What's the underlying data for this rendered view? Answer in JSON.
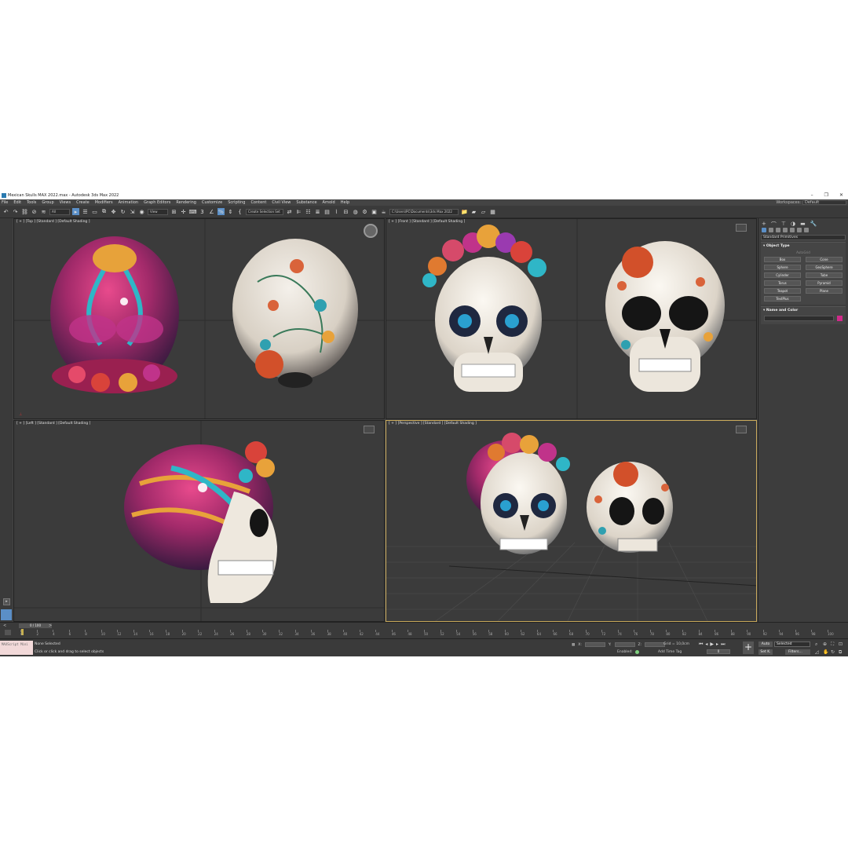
{
  "window": {
    "title": "Mexican Skulls MAX 2022.max - Autodesk 3ds Max 2022",
    "min_glyph": "–",
    "max_glyph": "❐",
    "close_glyph": "✕"
  },
  "menu": [
    "File",
    "Edit",
    "Tools",
    "Group",
    "Views",
    "Create",
    "Modifiers",
    "Animation",
    "Graph Editors",
    "Rendering",
    "Customize",
    "Scripting",
    "Content",
    "Civil View",
    "Substance",
    "Arnold",
    "Help"
  ],
  "workspace": {
    "label": "Workspaces:",
    "value": "Default"
  },
  "toolbar": {
    "filter": "All",
    "refcoord": "View",
    "selection_set": "Create Selection Set",
    "path": "C:\\Users\\PC\\Documents\\3ds Max 2022"
  },
  "viewports": {
    "top": {
      "label": "[ + ] [Top ] [Standard ] [Default Shading ]"
    },
    "front": {
      "label": "[ + ] [Front ] [Standard ] [Default Shading ]"
    },
    "left": {
      "label": "[ + ] [Left ] [Standard ] [Default Shading ]"
    },
    "perspective": {
      "label": "[ + ] [Perspective ] [Standard ] [Default Shading ]"
    }
  },
  "command_panel": {
    "category": "Standard Primitives",
    "object_type": {
      "title": "Object Type",
      "autogrid": "AutoGrid",
      "buttons": [
        "Box",
        "Cone",
        "Sphere",
        "GeoSphere",
        "Cylinder",
        "Tube",
        "Torus",
        "Pyramid",
        "Teapot",
        "Plane",
        "TextPlus"
      ]
    },
    "name_color": {
      "title": "Name and Color",
      "swatch": "#d02a8a"
    }
  },
  "timeline": {
    "slider": "0 / 100",
    "ticks": [
      "0",
      "2",
      "4",
      "6",
      "8",
      "10",
      "12",
      "14",
      "16",
      "18",
      "20",
      "22",
      "24",
      "26",
      "28",
      "30",
      "32",
      "34",
      "36",
      "38",
      "40",
      "42",
      "44",
      "46",
      "48",
      "50",
      "52",
      "54",
      "56",
      "58",
      "60",
      "62",
      "64",
      "66",
      "68",
      "70",
      "72",
      "74",
      "76",
      "78",
      "80",
      "82",
      "84",
      "86",
      "88",
      "90",
      "92",
      "94",
      "96",
      "98",
      "100"
    ]
  },
  "status": {
    "maxscript": "MAXScript Mini",
    "selection": "None Selected",
    "prompt": "Click or click and drag to select objects",
    "x_label": "X:",
    "y_label": "Y:",
    "z_label": "Z:",
    "grid": "Grid = 10,0cm",
    "enabled": "Enabled:",
    "add_time_tag": "Add Time Tag",
    "frame": "0",
    "auto": "Auto",
    "set_key": "Set K.",
    "selected": "Selected",
    "filters": "Filters..."
  },
  "colors": {
    "accent": "#5b8fc7",
    "active_viewport": "#c8a85a",
    "bg": "#444444"
  }
}
